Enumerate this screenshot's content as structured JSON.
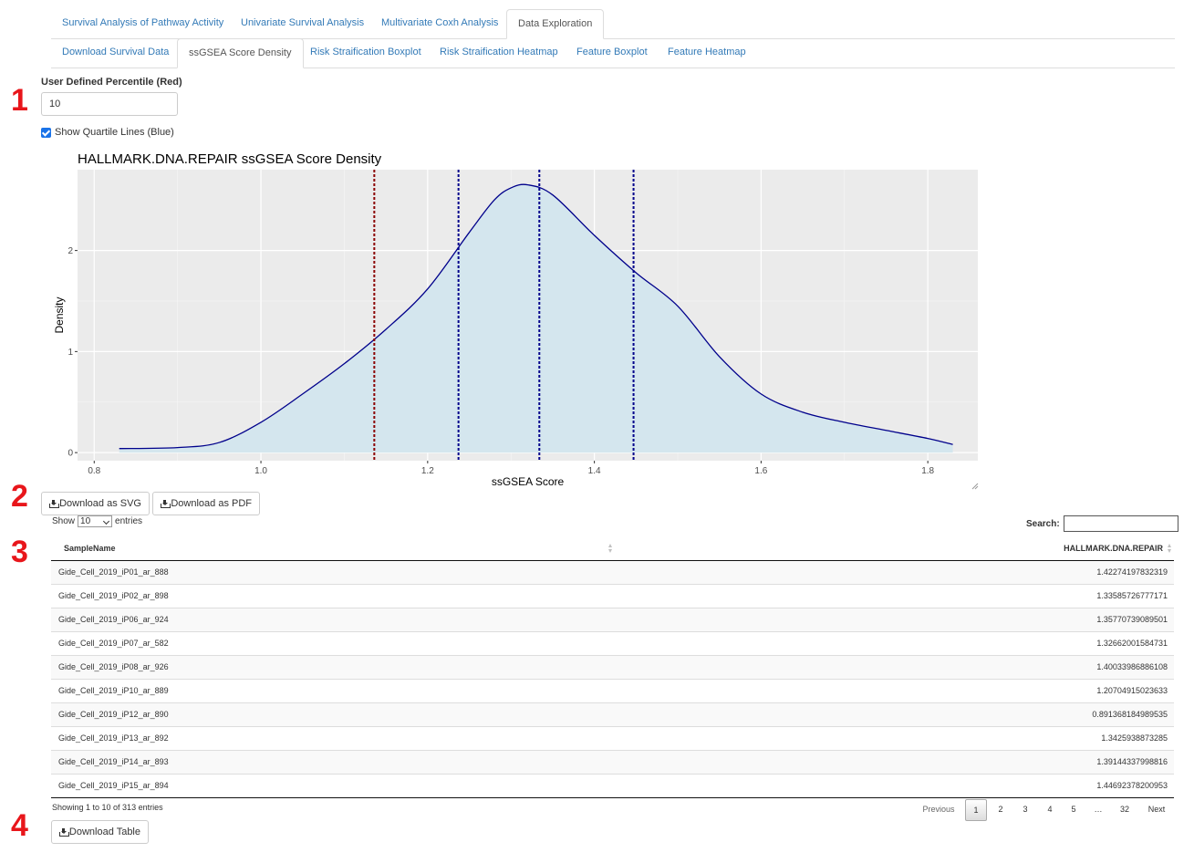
{
  "tabs_top": [
    {
      "label": "Survival Analysis of Pathway Activity",
      "active": false
    },
    {
      "label": "Univariate Survival Analysis",
      "active": false
    },
    {
      "label": "Multivariate Coxh Analysis",
      "active": false
    },
    {
      "label": "Data Exploration",
      "active": true
    }
  ],
  "tabs_sub": [
    {
      "label": "Download Survival Data",
      "active": false
    },
    {
      "label": "ssGSEA Score Density",
      "active": true
    },
    {
      "label": "Risk Straification Boxplot",
      "active": false
    },
    {
      "label": "Risk Straification Heatmap",
      "active": false
    },
    {
      "label": "Feature Boxplot",
      "active": false
    },
    {
      "label": "Feature Heatmap",
      "active": false
    }
  ],
  "markers": [
    "1",
    "2",
    "3",
    "4"
  ],
  "controls": {
    "percentile_label": "User Defined Percentile (Red)",
    "percentile_value": "10",
    "quartile_label": "Show Quartile Lines (Blue)",
    "quartile_checked": true
  },
  "plot": {
    "title": "HALLMARK.DNA.REPAIR  ssGSEA Score Density",
    "colors": {
      "fill": "#d4e6ee",
      "curve": "#00008b",
      "red_line": "#8b0000",
      "blue_line": "#00008b",
      "panel": "#ebebeb"
    }
  },
  "chart_data": {
    "type": "area",
    "title": "HALLMARK.DNA.REPAIR  ssGSEA Score Density",
    "xlabel": "ssGSEA Score",
    "ylabel": "Density",
    "xlim": [
      0.78,
      1.86
    ],
    "ylim": [
      -0.08,
      2.8
    ],
    "x_ticks": [
      "0.8",
      "1.0",
      "1.2",
      "1.4",
      "1.6",
      "1.8"
    ],
    "y_ticks": [
      "0",
      "1",
      "2"
    ],
    "grid": true,
    "x": [
      0.83,
      0.9,
      0.95,
      1.0,
      1.05,
      1.1,
      1.15,
      1.2,
      1.25,
      1.28,
      1.3,
      1.32,
      1.35,
      1.4,
      1.45,
      1.5,
      1.55,
      1.6,
      1.65,
      1.7,
      1.75,
      1.8,
      1.83
    ],
    "y": [
      0.04,
      0.05,
      0.1,
      0.3,
      0.58,
      0.88,
      1.22,
      1.62,
      2.18,
      2.5,
      2.62,
      2.65,
      2.55,
      2.15,
      1.78,
      1.45,
      0.95,
      0.58,
      0.4,
      0.3,
      0.22,
      0.14,
      0.08
    ],
    "vlines": [
      {
        "x": 1.136,
        "color": "#8b0000",
        "kind": "percentile"
      },
      {
        "x": 1.237,
        "color": "#00008b",
        "kind": "quartile"
      },
      {
        "x": 1.334,
        "color": "#00008b",
        "kind": "quartile"
      },
      {
        "x": 1.447,
        "color": "#00008b",
        "kind": "quartile"
      }
    ]
  },
  "buttons": {
    "svg": "Download as SVG",
    "pdf": "Download as PDF",
    "table": "Download Table"
  },
  "table": {
    "show_label": "Show",
    "entries_label": "entries",
    "page_length": "10",
    "search_label": "Search:",
    "columns": [
      "SampleName",
      "HALLMARK.DNA.REPAIR"
    ],
    "rows": [
      [
        "Gide_Cell_2019_iP01_ar_888",
        "1.42274197832319"
      ],
      [
        "Gide_Cell_2019_iP02_ar_898",
        "1.33585726777171"
      ],
      [
        "Gide_Cell_2019_iP06_ar_924",
        "1.35770739089501"
      ],
      [
        "Gide_Cell_2019_iP07_ar_582",
        "1.32662001584731"
      ],
      [
        "Gide_Cell_2019_iP08_ar_926",
        "1.40033986886108"
      ],
      [
        "Gide_Cell_2019_iP10_ar_889",
        "1.20704915023633"
      ],
      [
        "Gide_Cell_2019_iP12_ar_890",
        "0.891368184989535"
      ],
      [
        "Gide_Cell_2019_iP13_ar_892",
        "1.3425938873285"
      ],
      [
        "Gide_Cell_2019_iP14_ar_893",
        "1.39144337998816"
      ],
      [
        "Gide_Cell_2019_iP15_ar_894",
        "1.44692378200953"
      ]
    ],
    "info": "Showing 1 to 10 of 313 entries",
    "pagination": [
      "Previous",
      "1",
      "2",
      "3",
      "4",
      "5",
      "…",
      "32",
      "Next"
    ],
    "current_page": "1"
  }
}
